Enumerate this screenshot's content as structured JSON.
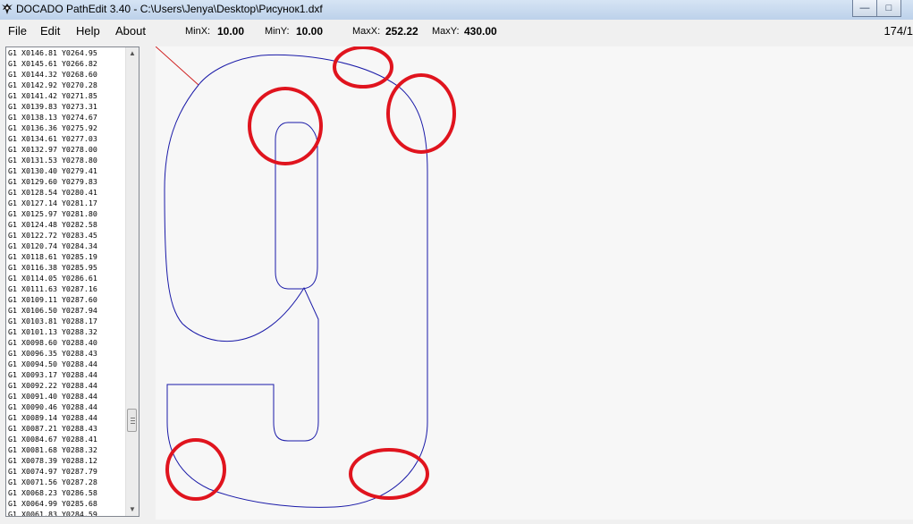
{
  "window": {
    "title": "DOCADO PathEdit 3.40  -  C:\\Users\\Jenya\\Desktop\\Рисунок1.dxf",
    "minimize_glyph": "—",
    "maximize_glyph": "□"
  },
  "menu": {
    "file": "File",
    "edit": "Edit",
    "help": "Help",
    "about": "About"
  },
  "stats": {
    "minx_label": "MinX:",
    "minx_value": "10.00",
    "miny_label": "MinY:",
    "miny_value": "10.00",
    "maxx_label": "MaxX:",
    "maxx_value": "252.22",
    "maxy_label": "MaxY:",
    "maxy_value": "430.00",
    "counter": "174/1"
  },
  "gcode_lines": [
    "G1 X0146.81 Y0264.95",
    "G1 X0145.61 Y0266.82",
    "G1 X0144.32 Y0268.60",
    "G1 X0142.92 Y0270.28",
    "G1 X0141.42 Y0271.85",
    "G1 X0139.83 Y0273.31",
    "G1 X0138.13 Y0274.67",
    "G1 X0136.36 Y0275.92",
    "G1 X0134.61 Y0277.03",
    "G1 X0132.97 Y0278.00",
    "G1 X0131.53 Y0278.80",
    "G1 X0130.40 Y0279.41",
    "G1 X0129.60 Y0279.83",
    "G1 X0128.54 Y0280.41",
    "G1 X0127.14 Y0281.17",
    "G1 X0125.97 Y0281.80",
    "G1 X0124.48 Y0282.58",
    "G1 X0122.72 Y0283.45",
    "G1 X0120.74 Y0284.34",
    "G1 X0118.61 Y0285.19",
    "G1 X0116.38 Y0285.95",
    "G1 X0114.05 Y0286.61",
    "G1 X0111.63 Y0287.16",
    "G1 X0109.11 Y0287.60",
    "G1 X0106.50 Y0287.94",
    "G1 X0103.81 Y0288.17",
    "G1 X0101.13 Y0288.32",
    "G1 X0098.60 Y0288.40",
    "G1 X0096.35 Y0288.43",
    "G1 X0094.50 Y0288.44",
    "G1 X0093.17 Y0288.44",
    "G1 X0092.22 Y0288.44",
    "G1 X0091.40 Y0288.44",
    "G1 X0090.46 Y0288.44",
    "G1 X0089.14 Y0288.44",
    "G1 X0087.21 Y0288.43",
    "G1 X0084.67 Y0288.41",
    "G1 X0081.68 Y0288.32",
    "G1 X0078.39 Y0288.12",
    "G1 X0074.97 Y0287.79",
    "G1 X0071.56 Y0287.28",
    "G1 X0068.23 Y0286.58",
    "G1 X0064.99 Y0285.68",
    "G1 X0061.83 Y0284.59"
  ],
  "colors": {
    "path": "#1a1aa8",
    "highlight": "#e0141e",
    "lead_in": "#d02020"
  }
}
